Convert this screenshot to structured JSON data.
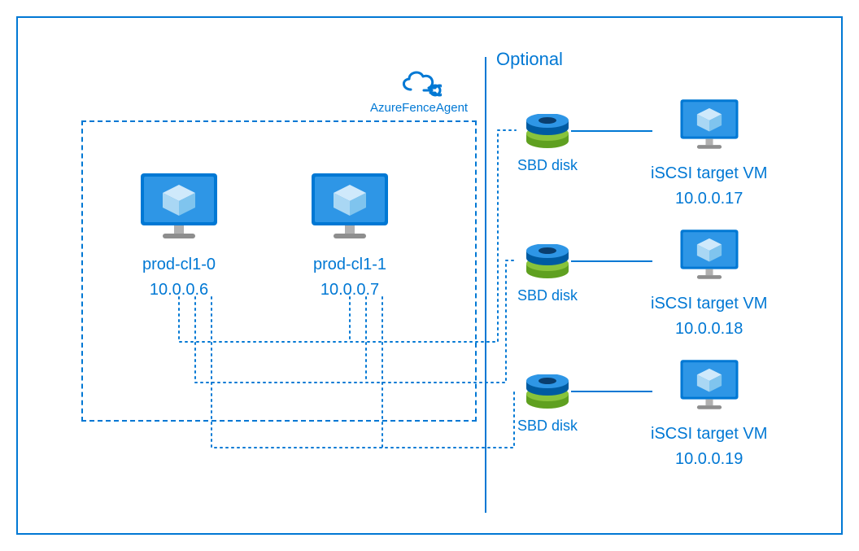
{
  "optional_label": "Optional",
  "cloud_label": "AzureFenceAgent",
  "cluster_nodes": [
    {
      "name": "prod-cl1-0",
      "ip": "10.0.0.6"
    },
    {
      "name": "prod-cl1-1",
      "ip": "10.0.0.7"
    }
  ],
  "sbd_label": "SBD disk",
  "targets": [
    {
      "name": "iSCSI target VM",
      "ip": "10.0.0.17"
    },
    {
      "name": "iSCSI target VM",
      "ip": "10.0.0.18"
    },
    {
      "name": "iSCSI target VM",
      "ip": "10.0.0.19"
    }
  ],
  "colors": {
    "accent": "#0078D4",
    "green": "#88c33b",
    "greenDark": "#5fa020",
    "blueDark": "#005ba1",
    "greyStand": "#b0b0b0"
  }
}
